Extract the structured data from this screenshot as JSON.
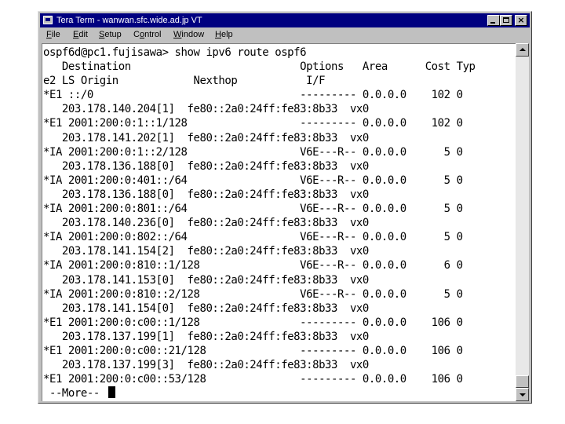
{
  "window": {
    "title": "Tera Term - wanwan.sfc.wide.ad.jp VT",
    "minimize_label": "_",
    "maximize_label": "□",
    "close_label": "×"
  },
  "menu": {
    "items": [
      {
        "accel": "F",
        "rest": "ile"
      },
      {
        "accel": "E",
        "rest": "dit"
      },
      {
        "accel": "S",
        "rest": "etup"
      },
      {
        "pre": "C",
        "accel": "o",
        "rest": "ntrol"
      },
      {
        "accel": "W",
        "rest": "indow"
      },
      {
        "accel": "H",
        "rest": "elp"
      }
    ]
  },
  "terminal": {
    "lines": [
      "ospf6d@pc1.fujisawa> show ipv6 route ospf6",
      "   Destination                           Options   Area      Cost Typ",
      "e2 LS Origin            Nexthop           I/F",
      "*E1 ::/0                                 --------- 0.0.0.0    102 0",
      "   203.178.140.204[1]  fe80::2a0:24ff:fe83:8b33  vx0",
      "*E1 2001:200:0:1::1/128                  --------- 0.0.0.0    102 0",
      "   203.178.141.202[1]  fe80::2a0:24ff:fe83:8b33  vx0",
      "*IA 2001:200:0:1::2/128                  V6E---R-- 0.0.0.0      5 0",
      "   203.178.136.188[0]  fe80::2a0:24ff:fe83:8b33  vx0",
      "*IA 2001:200:0:401::/64                  V6E---R-- 0.0.0.0      5 0",
      "   203.178.136.188[0]  fe80::2a0:24ff:fe83:8b33  vx0",
      "*IA 2001:200:0:801::/64                  V6E---R-- 0.0.0.0      5 0",
      "   203.178.140.236[0]  fe80::2a0:24ff:fe83:8b33  vx0",
      "*IA 2001:200:0:802::/64                  V6E---R-- 0.0.0.0      5 0",
      "   203.178.141.154[2]  fe80::2a0:24ff:fe83:8b33  vx0",
      "*IA 2001:200:0:810::1/128                V6E---R-- 0.0.0.0      6 0",
      "   203.178.141.153[0]  fe80::2a0:24ff:fe83:8b33  vx0",
      "*IA 2001:200:0:810::2/128                V6E---R-- 0.0.0.0      5 0",
      "   203.178.141.154[0]  fe80::2a0:24ff:fe83:8b33  vx0",
      "*E1 2001:200:0:c00::1/128                --------- 0.0.0.0    106 0",
      "   203.178.137.199[1]  fe80::2a0:24ff:fe83:8b33  vx0",
      "*E1 2001:200:0:c00::21/128               --------- 0.0.0.0    106 0",
      "   203.178.137.199[3]  fe80::2a0:24ff:fe83:8b33  vx0",
      "*E1 2001:200:0:c00::53/128               --------- 0.0.0.0    106 0",
      " --More-- "
    ]
  },
  "colors": {
    "titlebar": "#000080",
    "chrome": "#c0c0c0",
    "terminal_bg": "#ffffff",
    "terminal_fg": "#000000"
  }
}
